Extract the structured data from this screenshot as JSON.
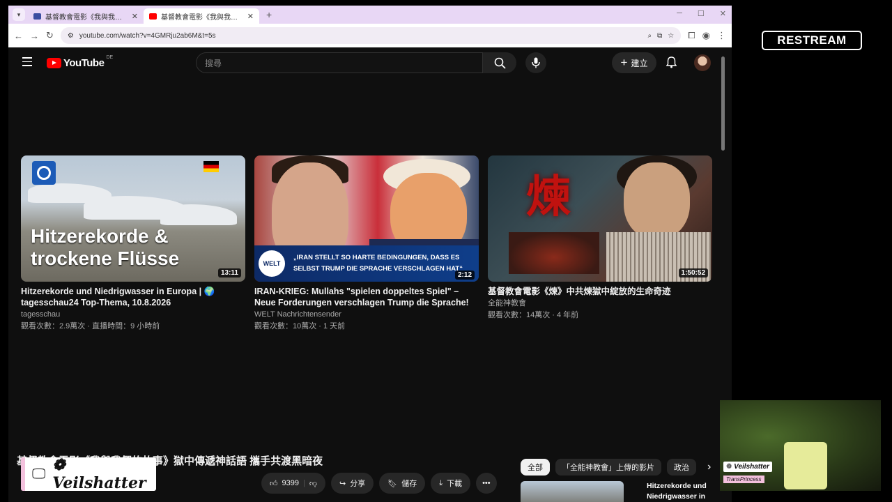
{
  "browser": {
    "tabs": [
      {
        "title": "基督教會電影《我與我們的故事",
        "active": false,
        "favicon_color": "#3b4ea0"
      },
      {
        "title": "基督教會電影《我與我們的故事",
        "active": true,
        "favicon_color": "#ff0000"
      }
    ],
    "url": "youtube.com/watch?v=4GMRju2ab6M&t=5s"
  },
  "youtube": {
    "logo_text": "YouTube",
    "region": "DE",
    "search_placeholder": "搜尋",
    "create_label": "建立"
  },
  "videos": [
    {
      "title": "Hitzerekorde und Niedrigwasser in Europa | 🌍 tagesschau24 Top-Thema, 10.8.2026",
      "channel": "tagesschau",
      "meta": "觀看次數：2.9萬次 · 直播時間：9 小時前",
      "duration": "13:11",
      "thumb_text": "Hitzerekorde & trockene Flüsse"
    },
    {
      "title": "IRAN-KRIEG: Mullahs \"spielen doppeltes Spiel\" – Neue Forderungen verschlagen Trump die Sprache!",
      "channel": "WELT Nachrichtensender",
      "meta": "觀看次數：10萬次 · 1 天前",
      "duration": "2:12",
      "thumb_text": "„IRAN STELLT SO HARTE BEDINGUNGEN, DASS ES SELBST TRUMP DIE SPRACHE VERSCHLAGEN HAT“",
      "badge": "WELT"
    },
    {
      "title": "基督教會電影《煉》中共煉獄中綻放的生命奇迹",
      "channel": "全能神教會",
      "meta": "觀看次數：14萬次 · 4 年前",
      "duration": "1:50:52",
      "thumb_text": "煉"
    }
  ],
  "watch": {
    "title": "基督教會電影《我與我們的故事》獄中傳遞神話語 攜手共渡黑暗夜",
    "like_count": "9399",
    "share_label": "分享",
    "save_label": "儲存",
    "download_label": "下載"
  },
  "chips": [
    "全部",
    "「全能神教會」上傳的影片",
    "政治"
  ],
  "upnext_title": "Hitzerekorde und Niedrigwasser in",
  "overlay": {
    "restream": "RESTREAM",
    "name": "Veilshatter",
    "cam_name": "Veilshatter",
    "cam_tag": "TransPrincess"
  }
}
